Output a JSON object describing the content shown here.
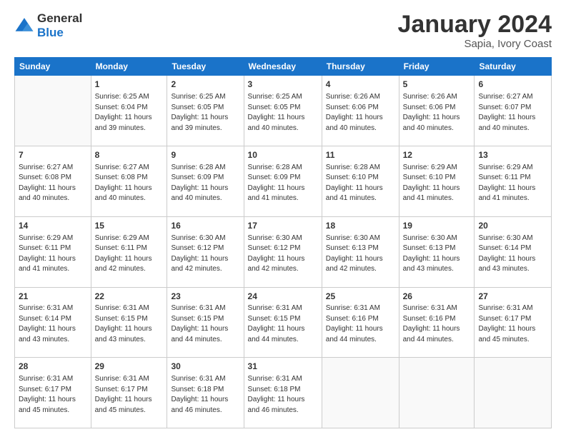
{
  "header": {
    "logo_general": "General",
    "logo_blue": "Blue",
    "main_title": "January 2024",
    "subtitle": "Sapia, Ivory Coast"
  },
  "calendar": {
    "days": [
      "Sunday",
      "Monday",
      "Tuesday",
      "Wednesday",
      "Thursday",
      "Friday",
      "Saturday"
    ],
    "weeks": [
      [
        {
          "day": "",
          "content": ""
        },
        {
          "day": "1",
          "content": "Sunrise: 6:25 AM\nSunset: 6:04 PM\nDaylight: 11 hours\nand 39 minutes."
        },
        {
          "day": "2",
          "content": "Sunrise: 6:25 AM\nSunset: 6:05 PM\nDaylight: 11 hours\nand 39 minutes."
        },
        {
          "day": "3",
          "content": "Sunrise: 6:25 AM\nSunset: 6:05 PM\nDaylight: 11 hours\nand 40 minutes."
        },
        {
          "day": "4",
          "content": "Sunrise: 6:26 AM\nSunset: 6:06 PM\nDaylight: 11 hours\nand 40 minutes."
        },
        {
          "day": "5",
          "content": "Sunrise: 6:26 AM\nSunset: 6:06 PM\nDaylight: 11 hours\nand 40 minutes."
        },
        {
          "day": "6",
          "content": "Sunrise: 6:27 AM\nSunset: 6:07 PM\nDaylight: 11 hours\nand 40 minutes."
        }
      ],
      [
        {
          "day": "7",
          "content": "Sunrise: 6:27 AM\nSunset: 6:08 PM\nDaylight: 11 hours\nand 40 minutes."
        },
        {
          "day": "8",
          "content": "Sunrise: 6:27 AM\nSunset: 6:08 PM\nDaylight: 11 hours\nand 40 minutes."
        },
        {
          "day": "9",
          "content": "Sunrise: 6:28 AM\nSunset: 6:09 PM\nDaylight: 11 hours\nand 40 minutes."
        },
        {
          "day": "10",
          "content": "Sunrise: 6:28 AM\nSunset: 6:09 PM\nDaylight: 11 hours\nand 41 minutes."
        },
        {
          "day": "11",
          "content": "Sunrise: 6:28 AM\nSunset: 6:10 PM\nDaylight: 11 hours\nand 41 minutes."
        },
        {
          "day": "12",
          "content": "Sunrise: 6:29 AM\nSunset: 6:10 PM\nDaylight: 11 hours\nand 41 minutes."
        },
        {
          "day": "13",
          "content": "Sunrise: 6:29 AM\nSunset: 6:11 PM\nDaylight: 11 hours\nand 41 minutes."
        }
      ],
      [
        {
          "day": "14",
          "content": "Sunrise: 6:29 AM\nSunset: 6:11 PM\nDaylight: 11 hours\nand 41 minutes."
        },
        {
          "day": "15",
          "content": "Sunrise: 6:29 AM\nSunset: 6:11 PM\nDaylight: 11 hours\nand 42 minutes."
        },
        {
          "day": "16",
          "content": "Sunrise: 6:30 AM\nSunset: 6:12 PM\nDaylight: 11 hours\nand 42 minutes."
        },
        {
          "day": "17",
          "content": "Sunrise: 6:30 AM\nSunset: 6:12 PM\nDaylight: 11 hours\nand 42 minutes."
        },
        {
          "day": "18",
          "content": "Sunrise: 6:30 AM\nSunset: 6:13 PM\nDaylight: 11 hours\nand 42 minutes."
        },
        {
          "day": "19",
          "content": "Sunrise: 6:30 AM\nSunset: 6:13 PM\nDaylight: 11 hours\nand 43 minutes."
        },
        {
          "day": "20",
          "content": "Sunrise: 6:30 AM\nSunset: 6:14 PM\nDaylight: 11 hours\nand 43 minutes."
        }
      ],
      [
        {
          "day": "21",
          "content": "Sunrise: 6:31 AM\nSunset: 6:14 PM\nDaylight: 11 hours\nand 43 minutes."
        },
        {
          "day": "22",
          "content": "Sunrise: 6:31 AM\nSunset: 6:15 PM\nDaylight: 11 hours\nand 43 minutes."
        },
        {
          "day": "23",
          "content": "Sunrise: 6:31 AM\nSunset: 6:15 PM\nDaylight: 11 hours\nand 44 minutes."
        },
        {
          "day": "24",
          "content": "Sunrise: 6:31 AM\nSunset: 6:15 PM\nDaylight: 11 hours\nand 44 minutes."
        },
        {
          "day": "25",
          "content": "Sunrise: 6:31 AM\nSunset: 6:16 PM\nDaylight: 11 hours\nand 44 minutes."
        },
        {
          "day": "26",
          "content": "Sunrise: 6:31 AM\nSunset: 6:16 PM\nDaylight: 11 hours\nand 44 minutes."
        },
        {
          "day": "27",
          "content": "Sunrise: 6:31 AM\nSunset: 6:17 PM\nDaylight: 11 hours\nand 45 minutes."
        }
      ],
      [
        {
          "day": "28",
          "content": "Sunrise: 6:31 AM\nSunset: 6:17 PM\nDaylight: 11 hours\nand 45 minutes."
        },
        {
          "day": "29",
          "content": "Sunrise: 6:31 AM\nSunset: 6:17 PM\nDaylight: 11 hours\nand 45 minutes."
        },
        {
          "day": "30",
          "content": "Sunrise: 6:31 AM\nSunset: 6:18 PM\nDaylight: 11 hours\nand 46 minutes."
        },
        {
          "day": "31",
          "content": "Sunrise: 6:31 AM\nSunset: 6:18 PM\nDaylight: 11 hours\nand 46 minutes."
        },
        {
          "day": "",
          "content": ""
        },
        {
          "day": "",
          "content": ""
        },
        {
          "day": "",
          "content": ""
        }
      ]
    ]
  }
}
